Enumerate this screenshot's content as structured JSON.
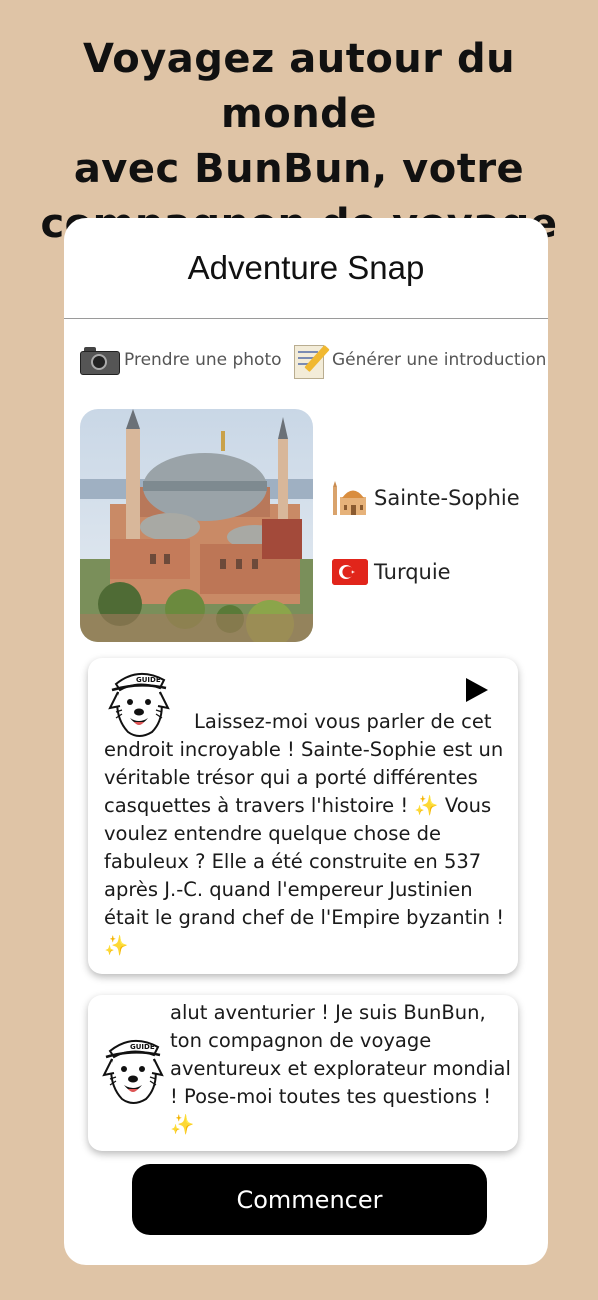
{
  "headline": {
    "line1": "Voyagez autour du monde",
    "line2": "avec BunBun, votre",
    "line3": "compagnon de voyage"
  },
  "app": {
    "title": "Adventure Snap",
    "actions": {
      "take_photo": {
        "label": "Prendre une photo",
        "icon": "camera-icon"
      },
      "generate_intro": {
        "label": "Générer une introduction",
        "icon": "memo-icon"
      }
    },
    "place": {
      "landmark": "Sainte-Sophie",
      "landmark_icon": "mosque-icon",
      "country": "Turquie",
      "country_icon": "turkey-flag-icon"
    },
    "messages": {
      "intro": {
        "text": "Laissez-moi vous parler de cet endroit incroyable ! Sainte-Sophie est un véritable trésor qui a porté différentes casquettes à travers l'histoire ! ✨ Vous voulez entendre quelque chose de fabuleux ? Elle a été construite en 537 après J.-C. quand l'empereur Justinien était le grand chef de l'Empire byzantin ! ✨",
        "play_icon": "play-icon"
      },
      "greeting": {
        "text": "alut aventurier ! Je suis BunBun, ton compagnon de voyage aventureux et explorateur mondial ! Pose-moi toutes tes questions ! ✨"
      }
    },
    "start_button": "Commencer"
  },
  "colors": {
    "background": "#dfc4a6",
    "card": "#ffffff",
    "button": "#000000"
  }
}
